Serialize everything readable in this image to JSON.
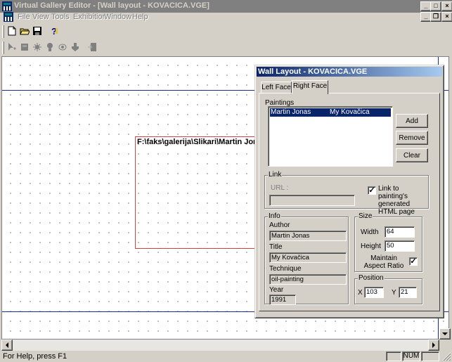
{
  "titlebar": {
    "title": "Virtual Gallery Editor - [Wall layout - KOVACICA.VGE]",
    "minimize": "_",
    "maximize": "□",
    "close": "×"
  },
  "menubar": {
    "items": [
      "File",
      "View",
      "Tools",
      "Exhibition",
      "Window",
      "Help"
    ],
    "child_minimize": "_",
    "child_restore": "❐",
    "child_close": "×"
  },
  "toolbar1": {
    "buttons": [
      "new-icon",
      "open-icon",
      "save-icon",
      "help-icon"
    ]
  },
  "toolbar2": {
    "buttons": [
      "select-icon",
      "wall-icon",
      "light-icon",
      "bulb-icon",
      "camera-icon",
      "hand-icon",
      "export-icon"
    ]
  },
  "canvas": {
    "painting_path": "F:\\faks\\galerija\\Slikari\\Martin Jon"
  },
  "status": {
    "text": "For Help, press F1",
    "num": "NUM"
  },
  "wall_layout": {
    "title": "Wall Layout - KOVACICA.VGE",
    "tabs": [
      "Left Face",
      "Right Face"
    ],
    "active_tab": "Right Face",
    "paintings": {
      "label": "Paintings",
      "rows": [
        {
          "author": "Martin Jonas",
          "title": "My Kovačica"
        }
      ],
      "add": "Add",
      "remove": "Remove",
      "clear": "Clear"
    },
    "link": {
      "label": "Link",
      "url_label": "URL :",
      "url_value": "",
      "checkbox_label": "Link to painting's generated HTML page",
      "checked": true
    },
    "info": {
      "label": "Info",
      "author_label": "Author",
      "author": "Martin Jonas",
      "title_label": "Title",
      "title": "My Kovačica",
      "technique_label": "Technique",
      "technique": "oil-painting",
      "year_label": "Year",
      "year": "1991"
    },
    "size": {
      "label": "Size",
      "width_label": "Width",
      "width": "64",
      "height_label": "Height",
      "height": "50",
      "aspect_label": "Maintain Aspect Ratio",
      "aspect_checked": true
    },
    "position": {
      "label": "Position",
      "x_label": "X",
      "x": "103",
      "y_label": "Y",
      "y": "21"
    }
  },
  "colors": {
    "active_title_start": "#0a246a",
    "active_title_end": "#a6caf0",
    "inactive_title": "#808080",
    "guide_line": "#1c2c8c",
    "painting_border": "#d84040"
  }
}
